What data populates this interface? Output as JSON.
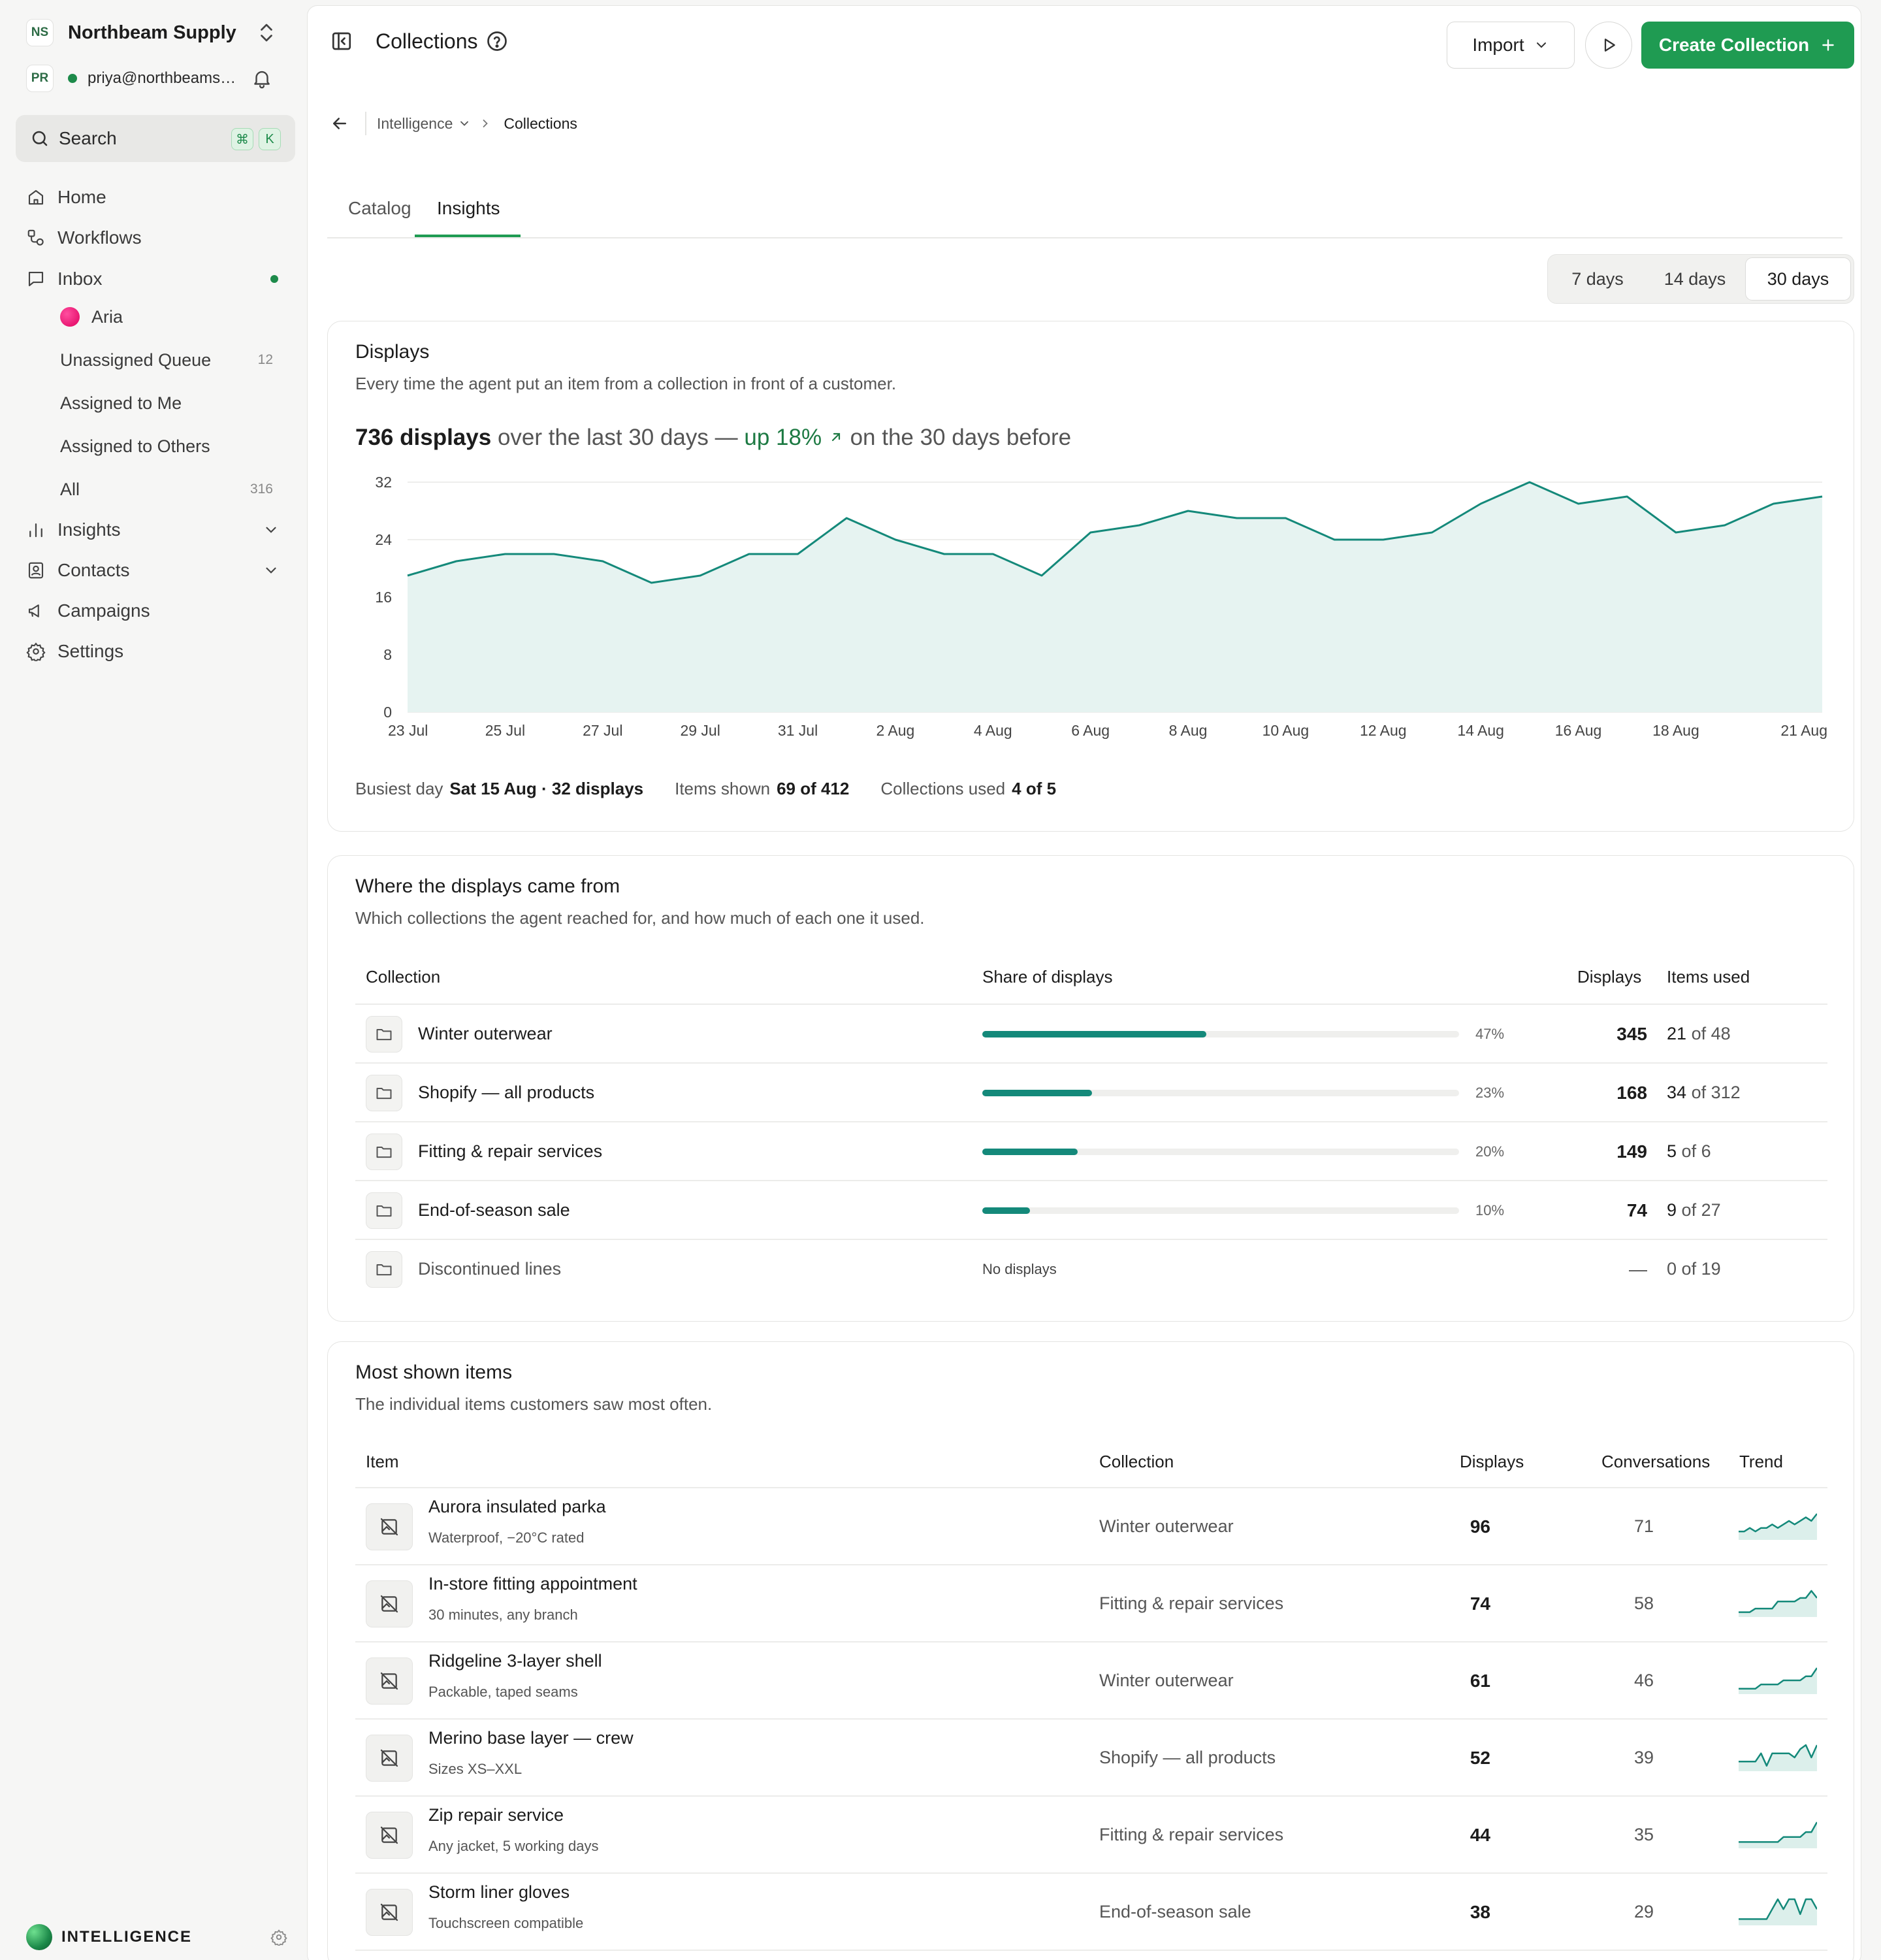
{
  "workspace": {
    "initials": "NS",
    "name": "Northbeam Supply"
  },
  "user": {
    "initials": "PR",
    "email": "priya@northbeamsu..."
  },
  "search": {
    "label": "Search",
    "kbd": [
      "⌘",
      "K"
    ]
  },
  "nav": {
    "home": "Home",
    "workflows": "Workflows",
    "inbox": "Inbox",
    "aria": "Aria",
    "unassigned": "Unassigned Queue",
    "unassigned_count": "12",
    "assigned_me": "Assigned to Me",
    "assigned_others": "Assigned to Others",
    "all": "All",
    "all_count": "316",
    "insights": "Insights",
    "contacts": "Contacts",
    "campaigns": "Campaigns",
    "settings": "Settings"
  },
  "footer": {
    "brand": "INTELLIGENCE"
  },
  "header": {
    "title": "Collections",
    "import_label": "Import",
    "create_label": "Create Collection"
  },
  "breadcrumb": {
    "parent": "Intelligence",
    "current": "Collections"
  },
  "tabs": [
    "Catalog",
    "Insights"
  ],
  "range": {
    "options": [
      "7 days",
      "14 days",
      "30 days"
    ],
    "selected": "30 days"
  },
  "displays_card": {
    "title": "Displays",
    "subtitle": "Every time the agent put an item from a collection in front of a customer.",
    "headline_count": "736 displays",
    "headline_mid": "over the last 30 days —",
    "headline_change": "up 18%",
    "headline_tail": "on the 30 days before",
    "stats": [
      {
        "label": "Busiest day",
        "value": "Sat 15 Aug · 32 displays"
      },
      {
        "label": "Items shown",
        "value": "69 of 412"
      },
      {
        "label": "Collections used",
        "value": "4 of 5"
      }
    ]
  },
  "chart_data": {
    "type": "area",
    "x": [
      "23 Jul",
      "24 Jul",
      "25 Jul",
      "26 Jul",
      "27 Jul",
      "28 Jul",
      "29 Jul",
      "30 Jul",
      "31 Jul",
      "1 Aug",
      "2 Aug",
      "3 Aug",
      "4 Aug",
      "5 Aug",
      "6 Aug",
      "7 Aug",
      "8 Aug",
      "9 Aug",
      "10 Aug",
      "11 Aug",
      "12 Aug",
      "13 Aug",
      "14 Aug",
      "15 Aug",
      "16 Aug",
      "17 Aug",
      "18 Aug",
      "19 Aug",
      "20 Aug",
      "21 Aug"
    ],
    "values": [
      19,
      21,
      22,
      22,
      21,
      18,
      19,
      22,
      22,
      27,
      24,
      22,
      22,
      19,
      25,
      26,
      28,
      27,
      27,
      24,
      24,
      25,
      29,
      32,
      29,
      30,
      25,
      26,
      29,
      30
    ],
    "xticks": [
      "23 Jul",
      "25 Jul",
      "27 Jul",
      "29 Jul",
      "31 Jul",
      "2 Aug",
      "4 Aug",
      "6 Aug",
      "8 Aug",
      "10 Aug",
      "12 Aug",
      "14 Aug",
      "16 Aug",
      "18 Aug",
      "21 Aug"
    ],
    "yticks": [
      0,
      8,
      16,
      24,
      32
    ],
    "ylim": [
      0,
      32
    ],
    "grid": true,
    "colors": {
      "line": "#14897a",
      "fill": "#e6f3f1"
    }
  },
  "sources_card": {
    "title": "Where the displays came from",
    "subtitle": "Which collections the agent reached for, and how much of each one it used.",
    "columns": [
      "Collection",
      "Share of displays",
      "Displays",
      "Items used"
    ],
    "rows": [
      {
        "name": "Winter outerwear",
        "share": 47,
        "share_label": "47%",
        "displays": "345",
        "used": "21",
        "total": "of 48"
      },
      {
        "name": "Shopify — all products",
        "share": 23,
        "share_label": "23%",
        "displays": "168",
        "used": "34",
        "total": "of 312"
      },
      {
        "name": "Fitting & repair services",
        "share": 20,
        "share_label": "20%",
        "displays": "149",
        "used": "5",
        "total": "of 6"
      },
      {
        "name": "End-of-season sale",
        "share": 10,
        "share_label": "10%",
        "displays": "74",
        "used": "9",
        "total": "of 27"
      },
      {
        "name": "Discontinued lines",
        "share": 0,
        "share_label": "No displays",
        "displays": "—",
        "used": "0",
        "total": "of 19"
      }
    ]
  },
  "items_card": {
    "title": "Most shown items",
    "subtitle": "The individual items customers saw most often.",
    "columns": [
      "Item",
      "Collection",
      "Displays",
      "Conversations",
      "Trend"
    ],
    "rows": [
      {
        "name": "Aurora insulated parka",
        "desc": "Waterproof, −20°C rated",
        "collection": "Winter outerwear",
        "displays": "96",
        "conversations": "71",
        "trend": [
          2,
          2,
          3,
          2,
          3,
          3,
          4,
          3,
          4,
          5,
          4,
          5,
          6,
          5,
          7
        ]
      },
      {
        "name": "In-store fitting appointment",
        "desc": "30 minutes, any branch",
        "collection": "Fitting & repair services",
        "displays": "74",
        "conversations": "58",
        "trend": [
          1,
          1,
          1,
          2,
          2,
          2,
          2,
          4,
          4,
          4,
          4,
          5,
          5,
          7,
          5
        ]
      },
      {
        "name": "Ridgeline 3-layer shell",
        "desc": "Packable, taped seams",
        "collection": "Winter outerwear",
        "displays": "61",
        "conversations": "46",
        "trend": [
          1,
          1,
          1,
          1,
          2,
          2,
          2,
          2,
          3,
          3,
          3,
          3,
          4,
          4,
          6
        ]
      },
      {
        "name": "Merino base layer — crew",
        "desc": "Sizes XS–XXL",
        "collection": "Shopify — all products",
        "displays": "52",
        "conversations": "39",
        "trend": [
          2,
          2,
          2,
          2,
          4,
          1,
          4,
          4,
          4,
          4,
          3,
          5,
          6,
          3,
          6
        ]
      },
      {
        "name": "Zip repair service",
        "desc": "Any jacket, 5 working days",
        "collection": "Fitting & repair services",
        "displays": "44",
        "conversations": "35",
        "trend": [
          1,
          1,
          1,
          1,
          1,
          1,
          1,
          1,
          2,
          2,
          2,
          2,
          3,
          3,
          5
        ]
      },
      {
        "name": "Storm liner gloves",
        "desc": "Touchscreen compatible",
        "collection": "End-of-season sale",
        "displays": "38",
        "conversations": "29",
        "trend": [
          1,
          1,
          1,
          1,
          1,
          1,
          3,
          5,
          3,
          5,
          5,
          2,
          5,
          5,
          3
        ]
      }
    ]
  },
  "colors": {
    "accent": "#1f9b52",
    "chart": "#14897a",
    "online": "#1d8a4a"
  },
  "icons": [
    "chevrons-updown-icon",
    "bell-icon",
    "search-icon",
    "home-icon",
    "workflow-icon",
    "inbox-icon",
    "bar-chart-icon",
    "contacts-icon",
    "megaphone-icon",
    "gear-icon",
    "panel-toggle-icon",
    "help-icon",
    "chevron-down-icon",
    "play-icon",
    "plus-icon",
    "arrow-left-icon",
    "chevron-right-icon",
    "folder-icon",
    "image-off-icon"
  ]
}
